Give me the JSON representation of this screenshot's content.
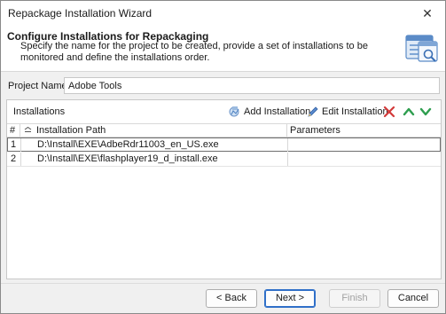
{
  "window": {
    "title": "Repackage Installation Wizard",
    "close_glyph": "✕"
  },
  "header": {
    "title": "Configure Installations for Repackaging",
    "description": "Specify the name for the project to be created, provide a set of installations to be monitored and define the installations order.",
    "icon": "wizard-window-icon"
  },
  "project": {
    "label": "Project Name:",
    "value": "Adobe Tools"
  },
  "installations": {
    "title": "Installations",
    "toolbar": {
      "add_label": "Add Installation",
      "edit_label": "Edit Installation",
      "add_icon": "add-installation-icon",
      "edit_icon": "pencil-icon",
      "delete_icon": "delete-x-icon",
      "up_icon": "move-up-icon",
      "down_icon": "move-down-icon"
    },
    "columns": {
      "num": "#",
      "path": "Installation Path",
      "params": "Parameters"
    },
    "rows": [
      {
        "num": "1",
        "path": "D:\\Install\\EXE\\AdbeRdr11003_en_US.exe",
        "params": ""
      },
      {
        "num": "2",
        "path": "D:\\Install\\EXE\\flashplayer19_d_install.exe",
        "params": ""
      }
    ]
  },
  "buttons": {
    "back": "< Back",
    "next": "Next >",
    "finish": "Finish",
    "cancel": "Cancel"
  },
  "colors": {
    "accent": "#2f6fc8",
    "delete": "#d33a3a",
    "arrows": "#2e9e4f"
  }
}
